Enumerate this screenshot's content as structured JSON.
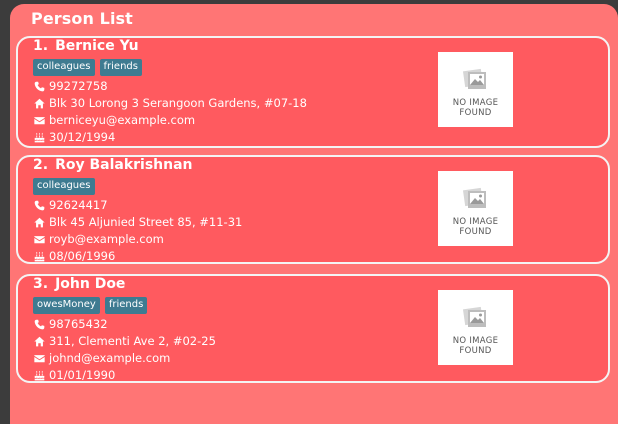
{
  "panel": {
    "title": "Person List"
  },
  "persons": [
    {
      "index": "1.",
      "name": "Bernice Yu",
      "tags": [
        "colleagues",
        "friends"
      ],
      "phone": "99272758",
      "address": "Blk 30 Lorong 3 Serangoon Gardens, #07-18",
      "email": "berniceyu@example.com",
      "birthday": "30/12/1994",
      "photo": {
        "line1": "NO IMAGE",
        "line2": "FOUND"
      }
    },
    {
      "index": "2.",
      "name": "Roy Balakrishnan",
      "tags": [
        "colleagues"
      ],
      "phone": "92624417",
      "address": "Blk 45 Aljunied Street 85, #11-31",
      "email": "royb@example.com",
      "birthday": "08/06/1996",
      "photo": {
        "line1": "NO IMAGE",
        "line2": "FOUND"
      }
    },
    {
      "index": "3.",
      "name": "John Doe",
      "tags": [
        "owesMoney",
        "friends"
      ],
      "phone": "98765432",
      "address": "311, Clementi Ave 2, #02-25",
      "email": "johnd@example.com",
      "birthday": "01/01/1990",
      "photo": {
        "line1": "NO IMAGE",
        "line2": "FOUND"
      }
    }
  ],
  "icons": {
    "phone": "phone-icon",
    "address": "home-icon",
    "email": "envelope-icon",
    "birthday": "birthday-cake-icon"
  },
  "colors": {
    "panel_bg": "#ff7575",
    "card_bg": "#ff5a5f",
    "tag_bg": "#3e7b91",
    "window_bg": "#3c3c3c"
  }
}
